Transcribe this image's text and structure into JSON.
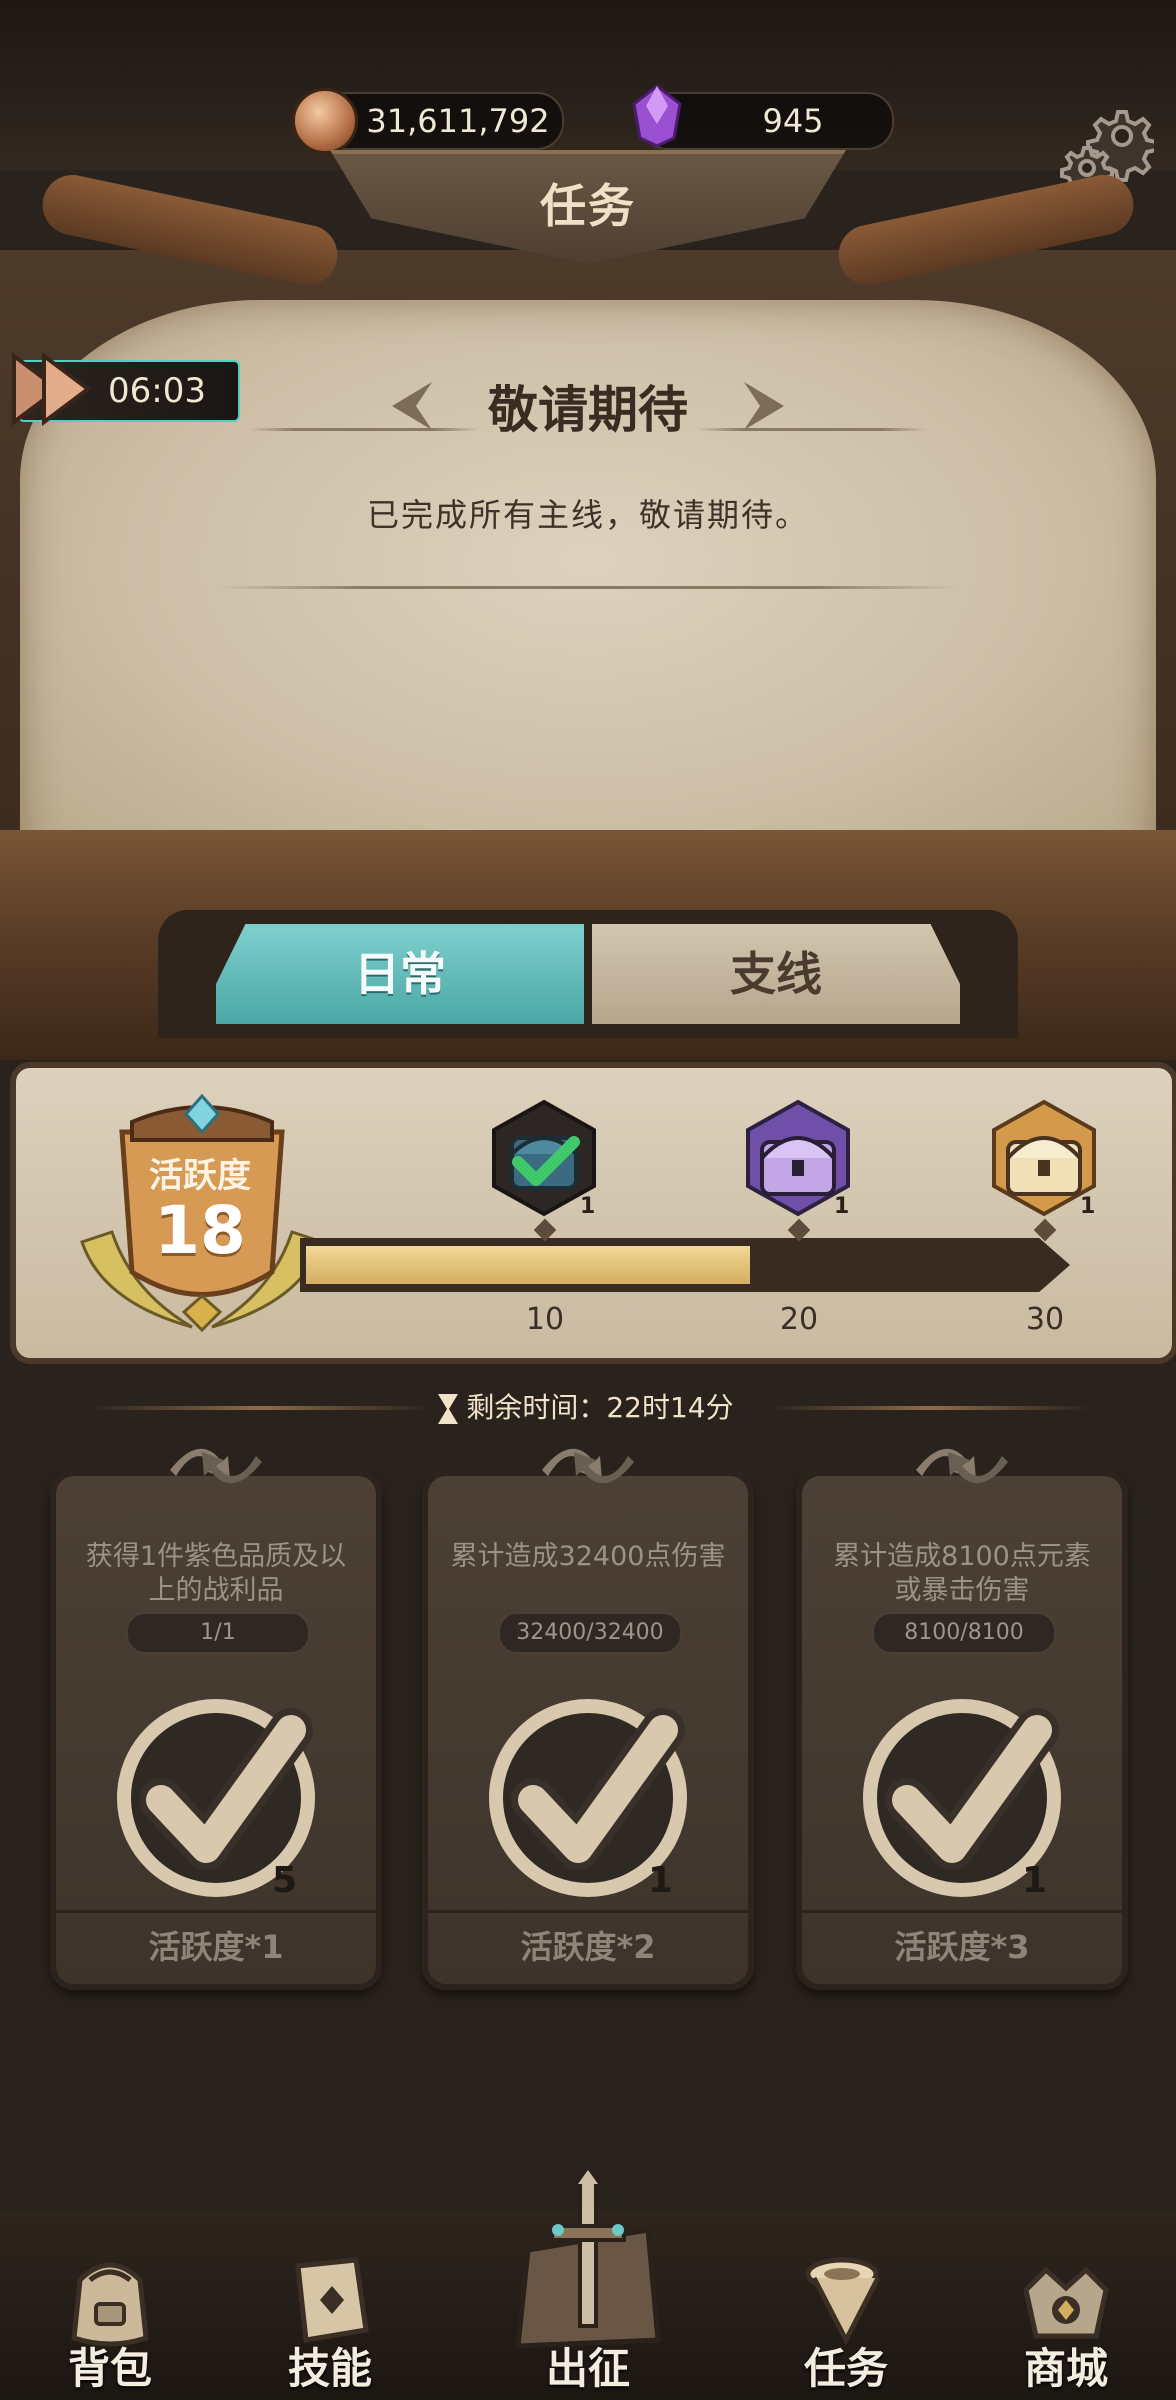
{
  "currency": {
    "coins": "31,611,792",
    "gems": "945"
  },
  "header": {
    "title": "任务"
  },
  "timer": {
    "value": "06:03"
  },
  "notice": {
    "title": "敬请期待",
    "text": "已完成所有主线，敬请期待。"
  },
  "tabs": [
    {
      "label": "日常",
      "active": true
    },
    {
      "label": "支线",
      "active": false
    }
  ],
  "activity": {
    "label": "活跃度",
    "value": "18",
    "progress_fraction": 0.6,
    "milestones": [
      {
        "threshold": "10",
        "count": "1",
        "claimed": true,
        "icon": "blue-chest-icon"
      },
      {
        "threshold": "20",
        "count": "1",
        "claimed": false,
        "icon": "purple-chest-icon"
      },
      {
        "threshold": "30",
        "count": "1",
        "claimed": false,
        "icon": "gold-chest-icon"
      }
    ]
  },
  "remaining": {
    "text": "剩余时间：22时14分"
  },
  "tasks": [
    {
      "desc": "获得1件紫色品质及以上的战利品",
      "progress": "1/1",
      "reward_count": "5",
      "reward": "活跃度*1",
      "completed": true
    },
    {
      "desc": "累计造成32400点伤害",
      "progress": "32400/32400",
      "reward_count": "1",
      "reward": "活跃度*2",
      "completed": true
    },
    {
      "desc": "累计造成8100点元素或暴击伤害",
      "progress": "8100/8100",
      "reward_count": "1",
      "reward": "活跃度*3",
      "completed": true
    }
  ],
  "nav": [
    {
      "label": "背包",
      "icon": "backpack-icon"
    },
    {
      "label": "技能",
      "icon": "skill-book-icon"
    },
    {
      "label": "出征",
      "icon": "expedition-sword-icon",
      "active": true
    },
    {
      "label": "任务",
      "icon": "quest-scroll-icon"
    },
    {
      "label": "商城",
      "icon": "shop-crown-icon"
    }
  ],
  "colors": {
    "accent_teal": "#6ec8c6",
    "progress_gold": "#e3c27a",
    "parchment": "#d5c9b3"
  }
}
